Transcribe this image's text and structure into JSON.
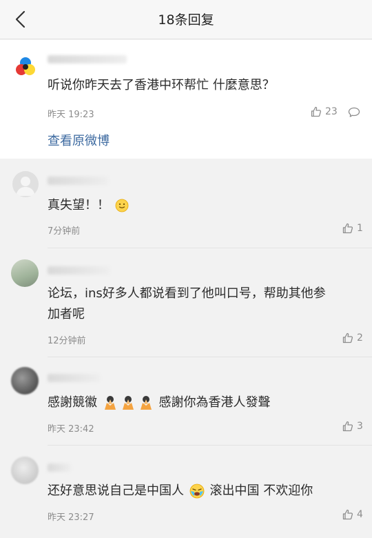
{
  "header": {
    "title": "18条回复",
    "back_icon": "back-chevron-icon"
  },
  "main_comment": {
    "text": "听说你昨天去了香港中环帮忙 什麼意思？",
    "time": "昨天 19:23",
    "likes": "23",
    "view_original": "查看原微博"
  },
  "replies": [
    {
      "text": "真失望！！",
      "time": "7分钟前",
      "likes": "1"
    },
    {
      "text_line1": "论坛，ins好多人都说看到了他叫口号，帮助其他参",
      "text_line2": "加者呢",
      "time": "12分钟前",
      "likes": "2"
    },
    {
      "text_a": "感謝競徽",
      "text_b": "感謝你為香港人發聲",
      "time": "昨天 23:42",
      "likes": "3"
    },
    {
      "text_a": "还好意思说自己是中国人",
      "text_b": "滚出中国 不欢迎你",
      "time": "昨天 23:27",
      "likes": "4"
    }
  ],
  "colors": {
    "link": "#3d6aa0",
    "meta": "#8c8c8c",
    "background": "#f2f2f2"
  }
}
